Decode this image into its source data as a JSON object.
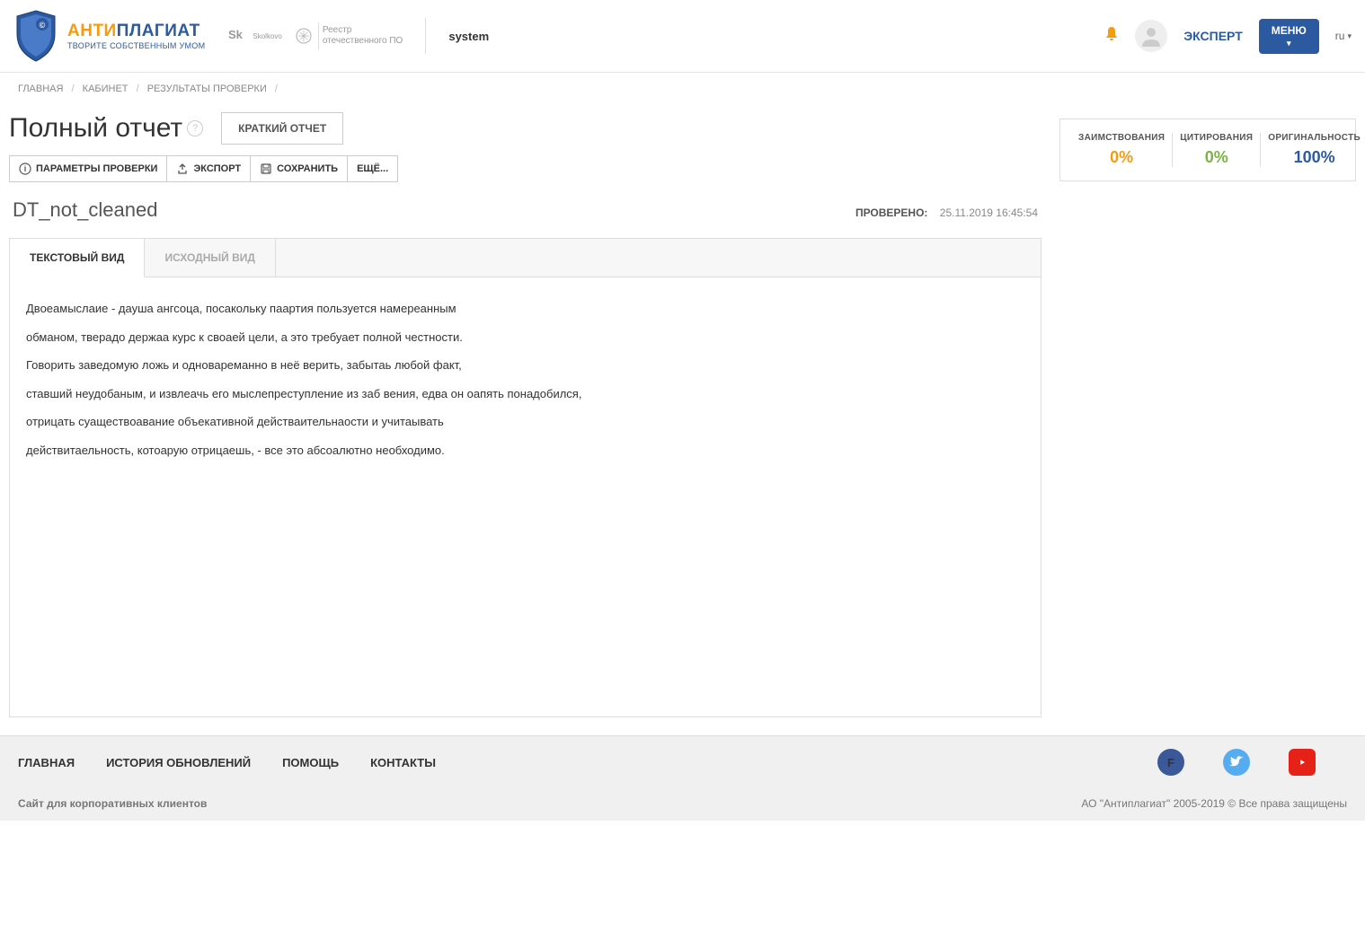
{
  "header": {
    "logo_anti": "АНТИ",
    "logo_plag": "ПЛАГИАТ",
    "logo_sub": "ТВОРИТЕ СОБСТВЕННЫМ УМОМ",
    "partner1": "Skolkovo",
    "partner2_line1": "Реестр",
    "partner2_line2": "отечественного ПО",
    "system": "system",
    "role": "ЭКСПЕРТ",
    "menu": "МЕНЮ",
    "lang": "ru"
  },
  "breadcrumb": {
    "items": [
      "ГЛАВНАЯ",
      "КАБИНЕТ",
      "РЕЗУЛЬТАТЫ ПРОВЕРКИ"
    ]
  },
  "page": {
    "title": "Полный отчет",
    "brief_btn": "КРАТКИЙ ОТЧЕТ"
  },
  "toolbar": {
    "params": "ПАРАМЕТРЫ ПРОВЕРКИ",
    "export": "ЭКСПОРТ",
    "save": "СОХРАНИТЬ",
    "more": "ЕЩЁ..."
  },
  "doc": {
    "name": "DT_not_cleaned",
    "checked_label": "ПРОВЕРЕНО:",
    "checked_date": "25.11.2019 16:45:54"
  },
  "tabs": {
    "text_view": "ТЕКСТОВЫЙ ВИД",
    "source_view": "ИСХОДНЫЙ ВИД"
  },
  "text_lines": [
    "Двоеамыслаие - дауша ангсоца, посакольку паартия пользуется намереанным",
    "обманом, тверадо держаа курс к своаей цели, а это требуает полной честности.",
    "Говорить заведомую ложь и одновареманно в неё верить, забытаь любой факт,",
    "ставший неудобаным, и извлеачь его мыслепреступление из заб вения, едва он оапять понадобился,",
    "отрицать суаществоавание объекативной действаительнаости и учитаывать",
    "действитаельность, котоарую отрицаешь, - все это абсоалютно необходимо."
  ],
  "stats": {
    "borrow_label": "ЗАИМСТВОВАНИЯ",
    "borrow_value": "0%",
    "citation_label": "ЦИТИРОВАНИЯ",
    "citation_value": "0%",
    "orig_label": "ОРИГИНАЛЬНОСТЬ",
    "orig_value": "100%"
  },
  "footer": {
    "nav": [
      "ГЛАВНАЯ",
      "ИСТОРИЯ ОБНОВЛЕНИЙ",
      "ПОМОЩЬ",
      "КОНТАКТЫ"
    ],
    "corp": "Сайт для корпоративных клиентов",
    "copyright": "АО \"Антиплагиат\" 2005-2019 © Все права защищены"
  }
}
